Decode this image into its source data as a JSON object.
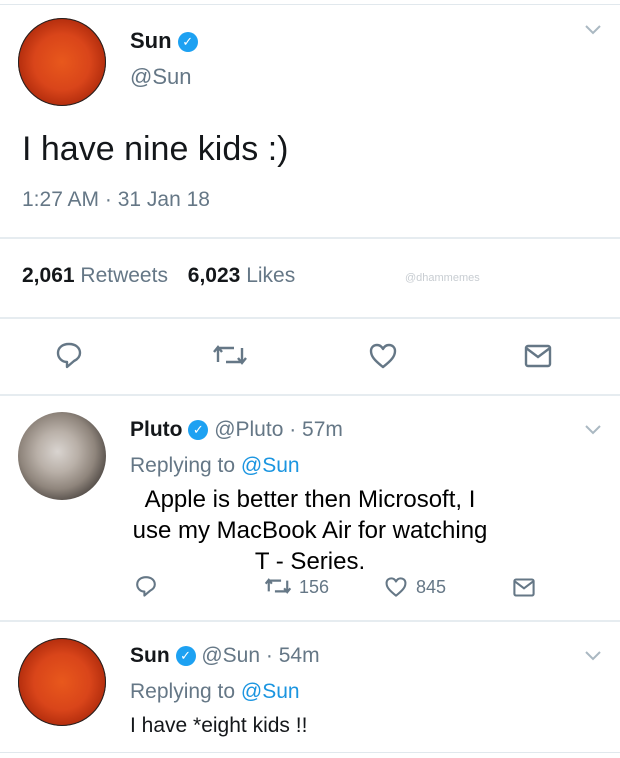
{
  "main_tweet": {
    "author_name": "Sun",
    "handle": "@Sun",
    "text": "I have nine kids :)",
    "timestamp": "1:27 AM · 31 Jan 18",
    "retweets_count": "2,061",
    "retweets_label": "Retweets",
    "likes_count": "6,023",
    "likes_label": "Likes",
    "watermark": "@dhammemes"
  },
  "reply1": {
    "author_name": "Pluto",
    "handle": "@Pluto",
    "time": "· 57m",
    "replying_to_label": "Replying to",
    "replying_to_handle": "@Sun",
    "text_line1": "Apple is better then Microsoft, I",
    "text_line2": "use my MacBook Air for watching",
    "text_line3": "T - Series.",
    "retweets": "156",
    "likes": "845"
  },
  "reply2": {
    "author_name": "Sun",
    "handle": "@Sun",
    "time": "· 54m",
    "replying_to_label": "Replying to",
    "replying_to_handle": "@Sun",
    "text": "I have *eight kids !!"
  }
}
